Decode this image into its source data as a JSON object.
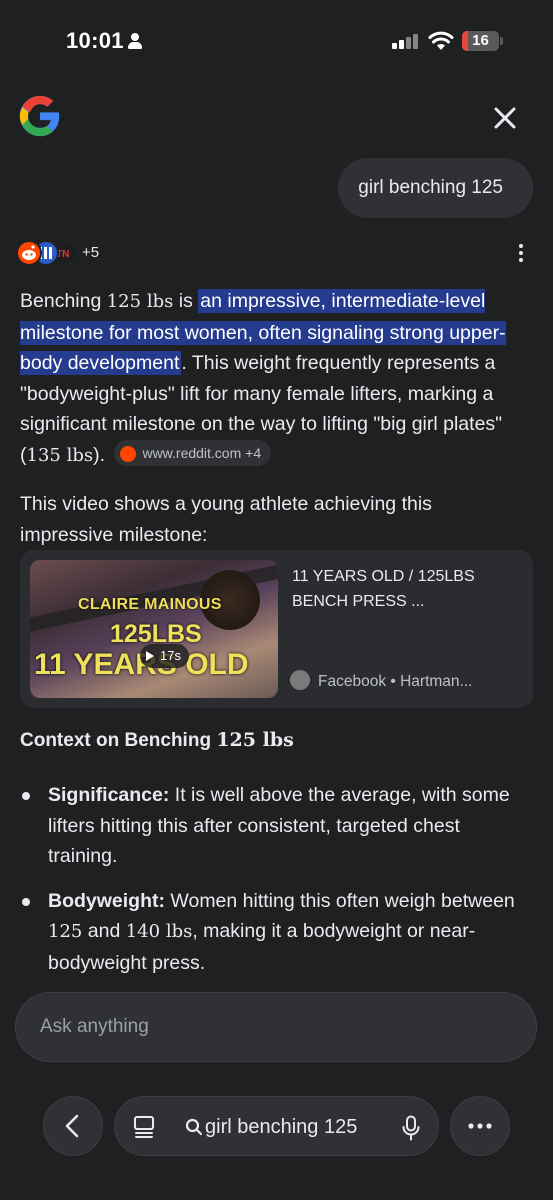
{
  "status_bar": {
    "time": "10:01",
    "battery": 16
  },
  "query": {
    "text": "girl benching 125"
  },
  "sources": {
    "more_label": "+5"
  },
  "answer": {
    "p1_prefix": "Benching ",
    "p1_num": "125 lbs",
    "p1_is": " is ",
    "p1_highlight": "an impressive, intermediate-level milestone for most women, often signaling strong upper-body development",
    "p1_rest": ". This weight frequently represents a \"bodyweight-plus\" lift for many female lifters, marking a significant milestone on the way to lifting \"big girl plates\" (",
    "p1_num2": "135 lbs",
    "p1_end": ").",
    "source_chip": "www.reddit.com +4"
  },
  "video": {
    "intro": "This video shows a young athlete achieving this impressive milestone:",
    "thumb_line1": "CLAIRE MAINOUS",
    "thumb_line2": "125LBS",
    "thumb_line3": "11 YEARS OLD",
    "duration": "17s",
    "title": "11 YEARS OLD / 125LBS BENCH PRESS ...",
    "source": "Facebook • Hartman..."
  },
  "context": {
    "heading_prefix": "Context on Benching ",
    "heading_num": "125 lbs",
    "bullets": [
      {
        "term": "Significance:",
        "text": " It is well above the average, with some lifters hitting this after consistent, targeted chest training."
      },
      {
        "term": "Bodyweight:",
        "text_a": " Women hitting this often weigh between ",
        "num_a": "125",
        "text_b": " and ",
        "num_b": "140 lbs",
        "text_c": ", making it a bodyweight or near-bodyweight press."
      }
    ]
  },
  "ask": {
    "placeholder": "Ask anything"
  },
  "bottom_bar": {
    "search_text": "girl benching 125"
  },
  "colors": {
    "background": "#1f2022",
    "highlight": "#253b8e",
    "card": "#303134"
  }
}
